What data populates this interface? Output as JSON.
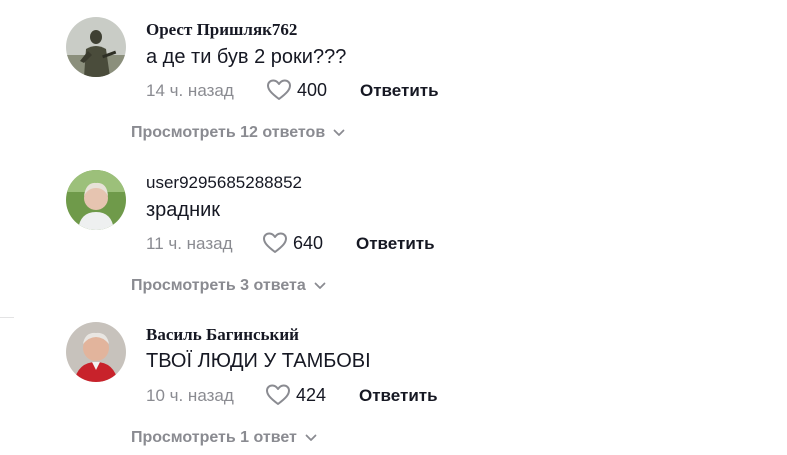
{
  "comments": [
    {
      "username": "Орест Пришляк762",
      "text": "а де ти був 2 роки???",
      "time": "14 ч. назад",
      "likes": "400",
      "reply_label": "Ответить",
      "view_replies": "Просмотреть 12 ответов",
      "avatar_icon": "avatar-soldier-photo"
    },
    {
      "username": "user9295685288852",
      "text": "зрадник",
      "time": "11 ч. назад",
      "likes": "640",
      "reply_label": "Ответить",
      "view_replies": "Просмотреть 3 ответа",
      "avatar_icon": "avatar-woman-photo"
    },
    {
      "username": "Василь Багинський",
      "text": "ТВОЇ ЛЮДИ У ТАМБОВІ",
      "time": "10 ч. назад",
      "likes": "424",
      "reply_label": "Ответить",
      "view_replies": "Просмотреть 1 ответ",
      "avatar_icon": "avatar-man-photo"
    }
  ],
  "icons": {
    "like": "heart-outline-icon",
    "expand": "chevron-down-icon"
  },
  "colors": {
    "primary_text": "#161823",
    "secondary_text": "#8a8b91"
  }
}
